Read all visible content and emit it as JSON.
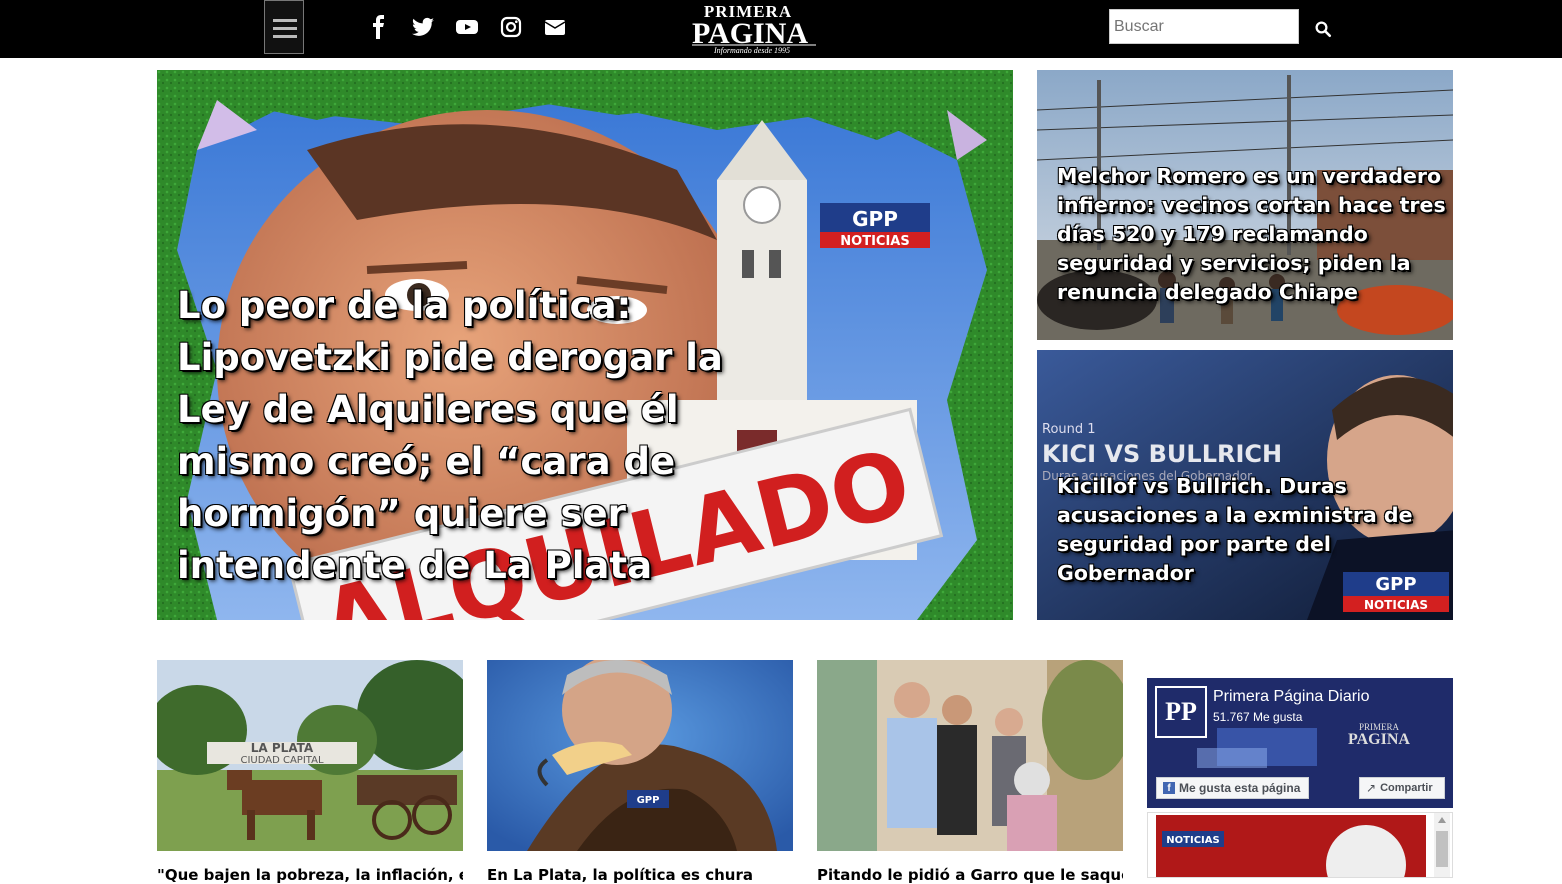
{
  "header": {
    "logo_top": "PRIMERA",
    "logo_main": "PAGINA",
    "logo_tagline": "Informando desde 1995",
    "search_placeholder": "Buscar",
    "social": [
      "facebook-icon",
      "twitter-icon",
      "youtube-icon",
      "instagram-icon",
      "envelope-icon"
    ]
  },
  "main_story": {
    "headline": "Lo peor de la política: Lipovetzki pide derogar la Ley de Alquileres que él mismo creó; el “cara de hormigón” quiere ser intendente de La Plata",
    "stamp": "ALQUILADO",
    "badge_top": "GPP",
    "badge_bottom": "NOTICIAS"
  },
  "side_stories": [
    {
      "headline": "Melchor Romero es un verdadero infierno: vecinos cortan hace tres días 520 y 179 reclamando seguridad y servicios; piden la renuncia delegado Chiape"
    },
    {
      "headline": "Kicillof vs Bullrich. Duras acusaciones a la exministra de seguridad por parte del Gobernador",
      "overlay_round": "Round 1",
      "overlay_title": "KICI VS BULLRICH",
      "overlay_sub": "Duras acusaciones del Gobernador",
      "badge_top": "GPP",
      "badge_bottom": "NOTICIAS"
    }
  ],
  "thumbs": [
    {
      "caption": "\"Que bajen la pobreza, la inflación, el",
      "sign_top": "LA PLATA",
      "sign_bottom": "CIUDAD CAPITAL"
    },
    {
      "caption": "En La Plata, la política es chura",
      "badge": "GPP"
    },
    {
      "caption": "Pitando le pidió a Garro que le saque"
    }
  ],
  "facebook": {
    "page_name": "Primera Página Diario",
    "likes": "51.767 Me gusta",
    "like_button": "Me gusta esta página",
    "share_button": "Compartir",
    "avatar": "PP"
  },
  "scroll_badge": "NOTICIAS",
  "colors": {
    "topbar": "#000000",
    "fb_bg": "#1f2b6a",
    "green": "#2e8b2e"
  }
}
